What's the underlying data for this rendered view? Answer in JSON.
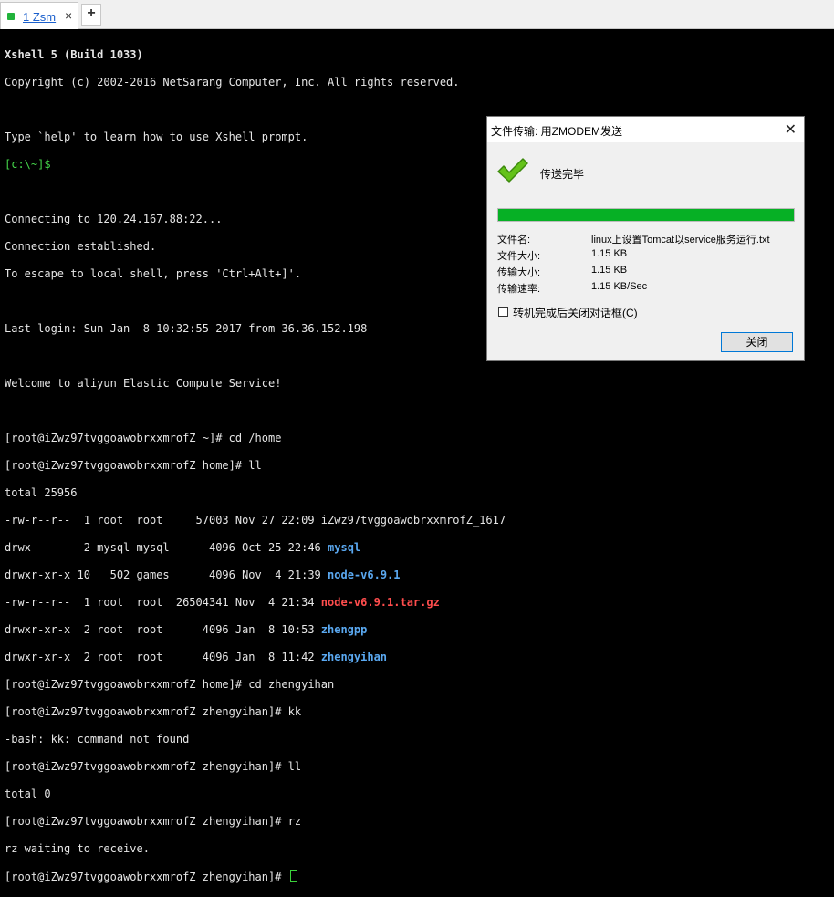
{
  "tabs": {
    "active_label": "1 Zsm",
    "close_glyph": "×",
    "new_glyph": "+"
  },
  "terminal": {
    "header1": "Xshell 5 (Build 1033)",
    "header2": "Copyright (c) 2002-2016 NetSarang Computer, Inc. All rights reserved.",
    "help": "Type `help' to learn how to use Xshell prompt.",
    "local_prompt": "[c:\\~]$",
    "connecting": "Connecting to 120.24.167.88:22...",
    "established": "Connection established.",
    "escape": "To escape to local shell, press 'Ctrl+Alt+]'.",
    "last_login": "Last login: Sun Jan  8 10:32:55 2017 from 36.36.152.198",
    "welcome": "Welcome to aliyun Elastic Compute Service!",
    "cmd_cd_home": "[root@iZwz97tvggoawobrxxmrofZ ~]# cd /home",
    "cmd_ll": "[root@iZwz97tvggoawobrxxmrofZ home]# ll",
    "total": "total 25956",
    "ls": [
      {
        "meta": "-rw-r--r--  1 root  root     57003 Nov 27 22:09 ",
        "name": "iZwz97tvggoawobrxxmrofZ_1617",
        "style": ""
      },
      {
        "meta": "drwx------  2 mysql mysql      4096 Oct 25 22:46 ",
        "name": "mysql",
        "style": "blue"
      },
      {
        "meta": "drwxr-xr-x 10   502 games      4096 Nov  4 21:39 ",
        "name": "node-v6.9.1",
        "style": "blue"
      },
      {
        "meta": "-rw-r--r--  1 root  root  26504341 Nov  4 21:34 ",
        "name": "node-v6.9.1.tar.gz",
        "style": "red"
      },
      {
        "meta": "drwxr-xr-x  2 root  root      4096 Jan  8 10:53 ",
        "name": "zhengpp",
        "style": "blue"
      },
      {
        "meta": "drwxr-xr-x  2 root  root      4096 Jan  8 11:42 ",
        "name": "zhengyihan",
        "style": "blue"
      }
    ],
    "cmd_cd_zyh": "[root@iZwz97tvggoawobrxxmrofZ home]# cd zhengyihan",
    "cmd_kk": "[root@iZwz97tvggoawobrxxmrofZ zhengyihan]# kk",
    "kk_err": "-bash: kk: command not found",
    "cmd_ll2": "[root@iZwz97tvggoawobrxxmrofZ zhengyihan]# ll",
    "total0": "total 0",
    "cmd_rz": "[root@iZwz97tvggoawobrxxmrofZ zhengyihan]# rz",
    "rz_wait": "rz waiting to receive.",
    "prompt_last": "[root@iZwz97tvggoawobrxxmrofZ zhengyihan]# "
  },
  "dialog": {
    "title": "文件传输: 用ZMODEM发送",
    "close_glyph": "✕",
    "status": "传送完毕",
    "progress": 1.0,
    "filename_label": "文件名:",
    "filename_value": "linux上设置Tomcat以service服务运行.txt",
    "filesize_label": "文件大小:",
    "filesize_value": "1.15 KB",
    "transferred_label": "传输大小:",
    "transferred_value": "1.15 KB",
    "speed_label": "传输速率:",
    "speed_value": "1.15 KB/Sec",
    "checkbox_label": "转机完成后关闭对话框(C)",
    "close_button": "关闭",
    "accent": "#06b025"
  }
}
